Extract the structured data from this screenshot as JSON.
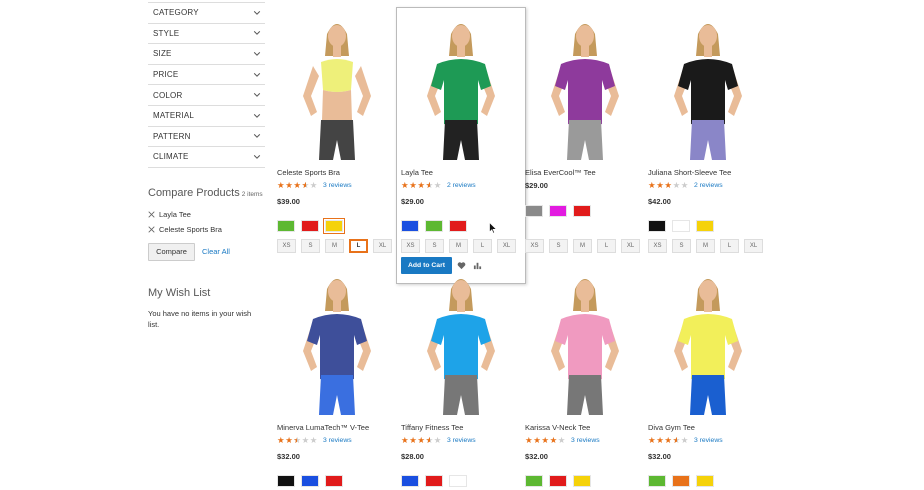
{
  "sidebar": {
    "filters": [
      "CATEGORY",
      "STYLE",
      "SIZE",
      "PRICE",
      "COLOR",
      "MATERIAL",
      "PATTERN",
      "CLIMATE"
    ],
    "compare": {
      "title": "Compare Products",
      "count": "2 items",
      "items": [
        "Layla Tee",
        "Celeste Sports Bra"
      ],
      "compare_button": "Compare",
      "clear_all": "Clear All"
    },
    "wishlist": {
      "title": "My Wish List",
      "empty_text": "You have no items in your wish list."
    }
  },
  "hover": {
    "add_to_cart": "Add to Cart"
  },
  "products": [
    {
      "name": "Celeste Sports Bra",
      "rating": 3.5,
      "reviews": "3 reviews",
      "price": "$39.00",
      "swatches": [
        "#5db832",
        "#e11b1b",
        "#f5d20a"
      ],
      "selected_swatch": 2,
      "sizes": [
        "XS",
        "S",
        "M",
        "L",
        "XL"
      ],
      "selected_size": 3,
      "top_color": "#eef07a",
      "bottom_color": "#444444",
      "garment": "bra"
    },
    {
      "name": "Layla Tee",
      "rating": 3.5,
      "reviews": "2 reviews",
      "price": "$29.00",
      "swatches": [
        "#1a4fe0",
        "#5db832",
        "#e11b1b"
      ],
      "selected_swatch": -1,
      "sizes": [
        "XS",
        "S",
        "M",
        "L",
        "XL"
      ],
      "selected_size": -1,
      "top_color": "#1e9a55",
      "bottom_color": "#222222",
      "garment": "tee"
    },
    {
      "name": "Elisa EverCool™ Tee",
      "rating": 0,
      "reviews": "",
      "price": "$29.00",
      "swatches": [
        "#8a8a8a",
        "#e21be0",
        "#e11b1b"
      ],
      "selected_swatch": -1,
      "sizes": [
        "XS",
        "S",
        "M",
        "L",
        "XL"
      ],
      "selected_size": -1,
      "top_color": "#8e3a9c",
      "bottom_color": "#9a9a9a",
      "garment": "tee"
    },
    {
      "name": "Juliana Short-Sleeve Tee",
      "rating": 3,
      "reviews": "2 reviews",
      "price": "$42.00",
      "swatches": [
        "#111111",
        "#ffffff",
        "#f5d20a"
      ],
      "selected_swatch": -1,
      "sizes": [
        "XS",
        "S",
        "M",
        "L",
        "XL"
      ],
      "selected_size": -1,
      "top_color": "#1a1a1a",
      "bottom_color": "#8a86c8",
      "garment": "tee"
    },
    {
      "name": "Minerva LumaTech™ V-Tee",
      "rating": 2.5,
      "reviews": "3 reviews",
      "price": "$32.00",
      "swatches": [
        "#111111",
        "#1a4fe0",
        "#e11b1b"
      ],
      "selected_swatch": -1,
      "sizes": [],
      "selected_size": -1,
      "top_color": "#3e4f9a",
      "bottom_color": "#3a6fe0",
      "garment": "tee"
    },
    {
      "name": "Tiffany Fitness Tee",
      "rating": 3.5,
      "reviews": "3 reviews",
      "price": "$28.00",
      "swatches": [
        "#1a4fe0",
        "#e11b1b",
        "#ffffff"
      ],
      "selected_swatch": -1,
      "sizes": [],
      "selected_size": -1,
      "top_color": "#1ea3e8",
      "bottom_color": "#777777",
      "garment": "tee"
    },
    {
      "name": "Karissa V-Neck Tee",
      "rating": 4,
      "reviews": "3 reviews",
      "price": "$32.00",
      "swatches": [
        "#5db832",
        "#e11b1b",
        "#f5d20a"
      ],
      "selected_swatch": -1,
      "sizes": [],
      "selected_size": -1,
      "top_color": "#f09ac0",
      "bottom_color": "#777777",
      "garment": "tee"
    },
    {
      "name": "Diva Gym Tee",
      "rating": 3.5,
      "reviews": "3 reviews",
      "price": "$32.00",
      "swatches": [
        "#5db832",
        "#e8721a",
        "#f5d20a"
      ],
      "selected_swatch": -1,
      "sizes": [],
      "selected_size": -1,
      "top_color": "#f2ef5a",
      "bottom_color": "#1a5fd0",
      "garment": "tee"
    }
  ],
  "colors": {
    "accent": "#1979c3",
    "star": "#e8721a",
    "selected": "#e8721a"
  }
}
